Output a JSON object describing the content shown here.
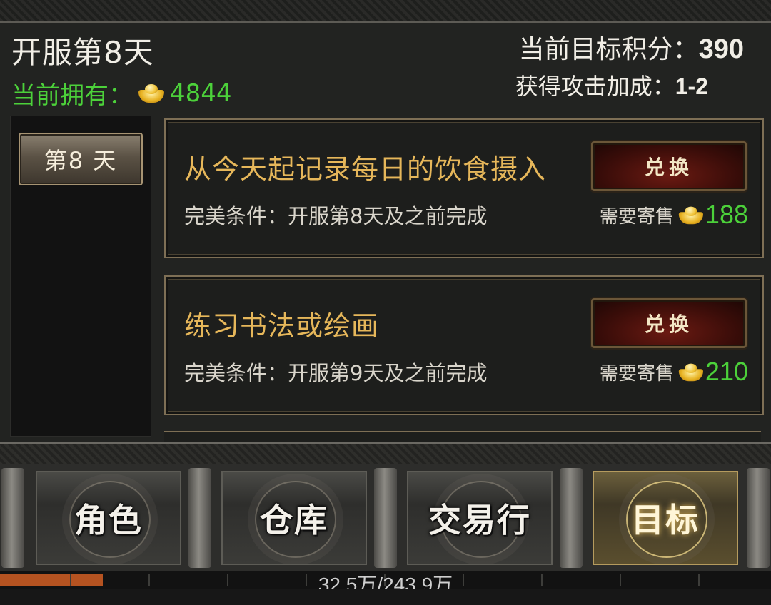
{
  "header": {
    "title": "开服第8天",
    "owned_label": "当前拥有：",
    "owned_value": "4844",
    "score_label": "当前目标积分：",
    "score_value": "390",
    "bonus_label": "获得攻击加成：",
    "bonus_value": "1-2"
  },
  "day_tab": {
    "label": "第8 天"
  },
  "tasks": [
    {
      "title": "从今天起记录每日的饮食摄入",
      "condition": "完美条件：开服第8天及之前完成",
      "button": "兑换",
      "need_label": "需要寄售",
      "need_value": "188"
    },
    {
      "title": "练习书法或绘画",
      "condition": "完美条件：开服第9天及之前完成",
      "button": "兑换",
      "need_label": "需要寄售",
      "need_value": "210"
    }
  ],
  "nav": {
    "items": [
      {
        "label": "角色",
        "active": false
      },
      {
        "label": "仓库",
        "active": false
      },
      {
        "label": "交易行",
        "active": false
      },
      {
        "label": "目标",
        "active": true
      }
    ]
  },
  "status": {
    "text": "32.5万/243.9万",
    "progress": 0.133
  },
  "icons": {
    "currency": "gold-ingot-icon"
  },
  "colors": {
    "green": "#4cd13a",
    "gold_title": "#e6b75a",
    "button_red": "#3b0d09"
  }
}
